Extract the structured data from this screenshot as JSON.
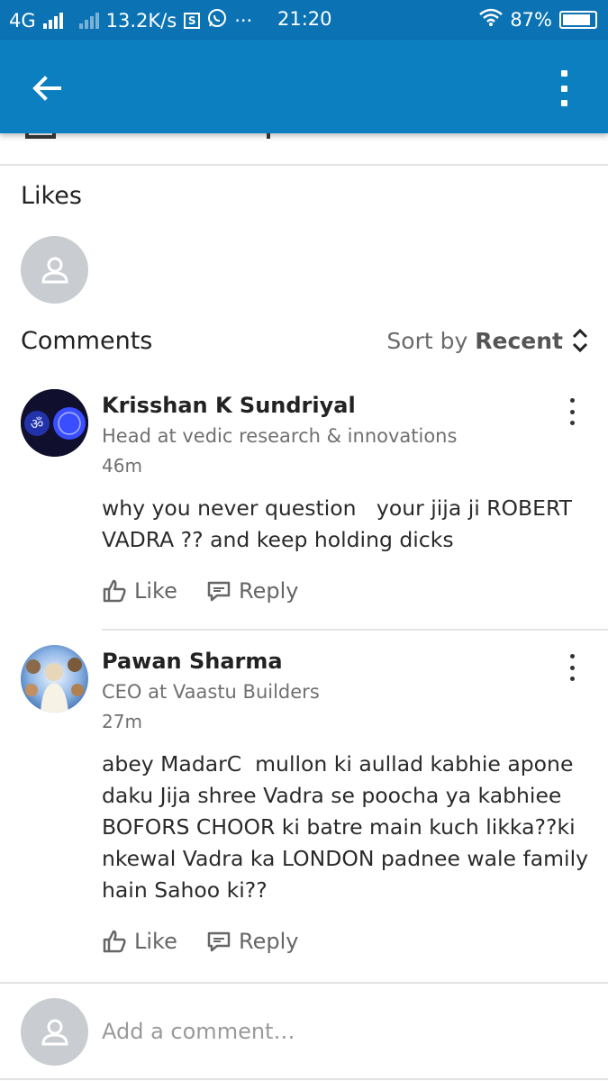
{
  "status_bar": {
    "network": "4G",
    "speed": "13.2K/s",
    "sim_badge": "S",
    "overflow": "···",
    "time": "21:20",
    "battery_text": "87%",
    "battery_level": 0.87
  },
  "likes": {
    "title": "Likes"
  },
  "comments_header": {
    "title": "Comments",
    "sort_prefix": "Sort by",
    "sort_value": "Recent"
  },
  "comments": [
    {
      "author": "Krisshan K Sundriyal",
      "headline": "Head at vedic research & innovations",
      "time": "46m",
      "text": "why you never question   your jija ji ROBERT VADRA ?? and keep holding dicks",
      "like_label": "Like",
      "reply_label": "Reply",
      "avatar_icon": "om-symbol-icon"
    },
    {
      "author": "Pawan Sharma",
      "headline": "CEO at Vaastu Builders",
      "time": "27m",
      "text": "abey MadarC  mullon ki aullad kabhie apone daku Jija shree Vadra se poocha ya kabhiee BOFORS CHOOR ki batre main kuch likka??ki nkewal Vadra ka LONDON padnee wale family hain Sahoo ki??",
      "like_label": "Like",
      "reply_label": "Reply",
      "avatar_icon": "deity-photo-icon"
    }
  ],
  "composer": {
    "placeholder": "Add a comment…"
  },
  "colors": {
    "status_bar": "#0b73b3",
    "app_bar": "#0b7fc0",
    "placeholder_avatar": "#c9cdd1"
  }
}
